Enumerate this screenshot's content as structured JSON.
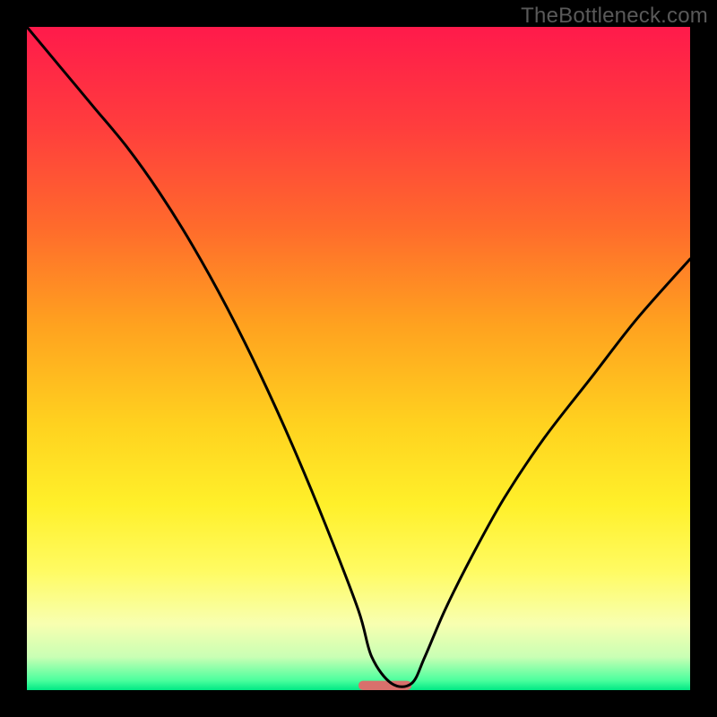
{
  "watermark": "TheBottleneck.com",
  "chart_data": {
    "type": "line",
    "title": "",
    "xlabel": "",
    "ylabel": "",
    "xlim": [
      0,
      100
    ],
    "ylim": [
      0,
      100
    ],
    "x": [
      0,
      5,
      10,
      15,
      20,
      25,
      30,
      35,
      40,
      45,
      50,
      52,
      55,
      58,
      60,
      63,
      67,
      72,
      78,
      85,
      92,
      100
    ],
    "values": [
      100,
      94,
      88,
      82,
      75,
      67,
      58,
      48,
      37,
      25,
      12,
      5,
      1,
      1,
      5,
      12,
      20,
      29,
      38,
      47,
      56,
      65
    ],
    "gradient_stops": [
      {
        "offset": 0.0,
        "color": "#ff1a4b"
      },
      {
        "offset": 0.15,
        "color": "#ff3d3d"
      },
      {
        "offset": 0.3,
        "color": "#ff6a2c"
      },
      {
        "offset": 0.45,
        "color": "#ffa21f"
      },
      {
        "offset": 0.6,
        "color": "#ffd21f"
      },
      {
        "offset": 0.72,
        "color": "#fff02a"
      },
      {
        "offset": 0.82,
        "color": "#fffb62"
      },
      {
        "offset": 0.9,
        "color": "#f8ffb0"
      },
      {
        "offset": 0.95,
        "color": "#c9ffb4"
      },
      {
        "offset": 0.985,
        "color": "#4dff9e"
      },
      {
        "offset": 1.0,
        "color": "#00e884"
      }
    ],
    "marker": {
      "x_start": 50,
      "x_end": 58,
      "y": 0,
      "color": "#d9706c",
      "thickness_pct": 1.4
    }
  }
}
